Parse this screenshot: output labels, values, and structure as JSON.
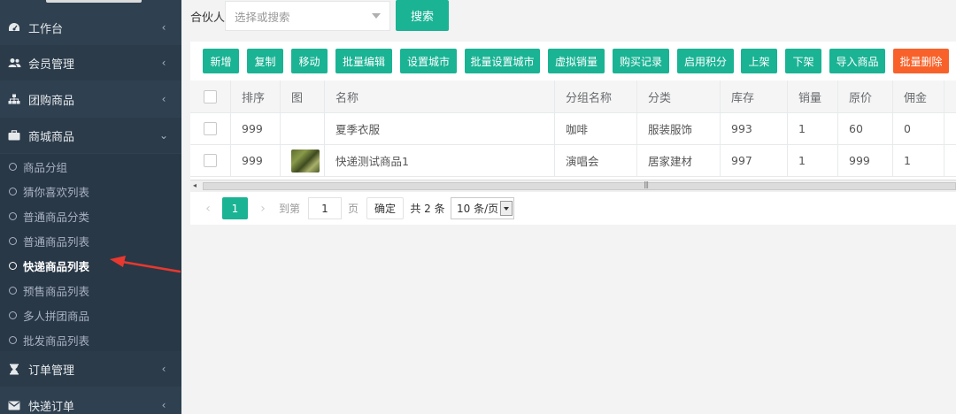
{
  "sidebar": {
    "menu": [
      {
        "label": "工作台",
        "icon": "dashboard-icon",
        "arrow": "‹"
      },
      {
        "label": "会员管理",
        "icon": "users-icon",
        "arrow": "‹"
      },
      {
        "label": "团购商品",
        "icon": "sitemap-icon",
        "arrow": "‹"
      },
      {
        "label": "商城商品",
        "icon": "briefcase-icon",
        "arrow": "⌄"
      }
    ],
    "submenu": [
      {
        "label": "商品分组"
      },
      {
        "label": "猜你喜欢列表"
      },
      {
        "label": "普通商品分类"
      },
      {
        "label": "普通商品列表"
      },
      {
        "label": "快递商品列表"
      },
      {
        "label": "预售商品列表"
      },
      {
        "label": "多人拼团商品"
      },
      {
        "label": "批发商品列表"
      }
    ],
    "menu_bottom": [
      {
        "label": "订单管理",
        "icon": "hourglass-icon",
        "arrow": "‹"
      },
      {
        "label": "快递订单",
        "icon": "envelope-icon",
        "arrow": "‹"
      }
    ]
  },
  "filter": {
    "label": "合伙人",
    "placeholder": "选择或搜索",
    "search_label": "搜索"
  },
  "toolbar": {
    "buttons": [
      "新增",
      "复制",
      "移动",
      "批量编辑",
      "设置城市",
      "批量设置城市",
      "虚拟销量",
      "购买记录",
      "启用积分",
      "上架",
      "下架",
      "导入商品",
      "批量删除"
    ]
  },
  "table": {
    "headers": [
      "排序",
      "图",
      "名称",
      "分组名称",
      "分类",
      "库存",
      "销量",
      "原价",
      "佣金"
    ],
    "rows": [
      {
        "sort": "999",
        "image": "",
        "name": "夏季衣服",
        "group": "咖啡",
        "category": "服装服饰",
        "stock": "993",
        "sales": "1",
        "price": "60",
        "commission": "0"
      },
      {
        "sort": "999",
        "image": "product-thumbnail",
        "name": "快递测试商品1",
        "group": "演唱会",
        "category": "居家建材",
        "stock": "997",
        "sales": "1",
        "price": "999",
        "commission": "1"
      }
    ]
  },
  "pagination": {
    "prev": "‹",
    "current": "1",
    "next": "›",
    "goto_label": "到第",
    "goto_value": "1",
    "page_unit": "页",
    "confirm": "确定",
    "total": "共 2 条",
    "page_size": "10 条/页"
  },
  "colors": {
    "sidebar_bg": "#2f4050",
    "accent": "#1ab394",
    "danger": "#f8622a",
    "annotation_arrow": "#e8382f"
  }
}
